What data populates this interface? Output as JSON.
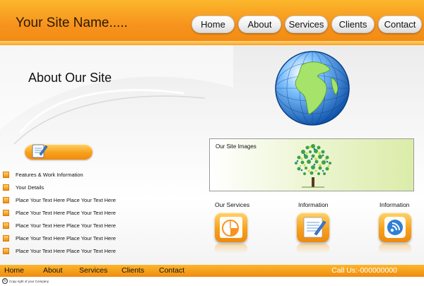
{
  "header": {
    "site_name": "Your Site Name.....",
    "nav": [
      "Home",
      "About",
      "Services",
      "Clients",
      "Contact"
    ]
  },
  "main": {
    "title": "About Our Site",
    "list_items": [
      "Features & Work Information",
      "Your Details",
      "Place Your Text Here Place Your Text Here",
      "Place Your Text Here Place Your Text Here",
      "Place Your Text Here Place Your Text Here",
      "Place Your Text Here Place Your Text Here",
      "Place Your Text Here Place Your Text Here"
    ],
    "images_title": "Our Site Images",
    "services": [
      "Our Services",
      "Information",
      "Information"
    ],
    "icons": [
      "pie-chart-icon",
      "notepad-pencil-icon",
      "signal-icon",
      "globe-icon",
      "tree-icon",
      "notepad-pencil-icon"
    ]
  },
  "footer": {
    "nav": [
      "Home",
      "About",
      "Services",
      "Clients",
      "Contact"
    ],
    "call_us": "Call Us:-000000000",
    "copyright": "Copy right of your Company"
  },
  "colors": {
    "accent": "#f7931e",
    "accent_light": "#fbb72b",
    "globe_blue": "#1e6fc9",
    "land_green": "#8fd14f"
  }
}
